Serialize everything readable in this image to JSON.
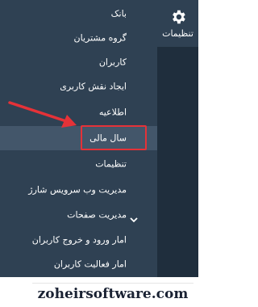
{
  "side_tab": {
    "label": "تنظیمات",
    "icon": "gear-icon"
  },
  "menu": {
    "items": [
      {
        "label": "بانک"
      },
      {
        "label": "گروه مشتریان"
      },
      {
        "label": "کاربران"
      },
      {
        "label": "ایجاد نقش کاربری"
      },
      {
        "label": "اطلاعیه"
      },
      {
        "label": "سال مالی",
        "active": true
      },
      {
        "label": "تنظیمات"
      },
      {
        "label": "مدیریت وب سرویس شارژ"
      },
      {
        "label": "مدیریت صفحات",
        "expandable": true
      },
      {
        "label": "امار ورود و خروج کاربران"
      },
      {
        "label": "امار فعالیت کاربران"
      }
    ]
  },
  "annotation": {
    "arrow_color": "#e53238",
    "highlight_color": "#e53238"
  },
  "watermark": {
    "text": "zoheirsoftware.com"
  },
  "colors": {
    "panel": "#2f4153",
    "strip": "#1f2e3d",
    "active": "#43566a"
  }
}
